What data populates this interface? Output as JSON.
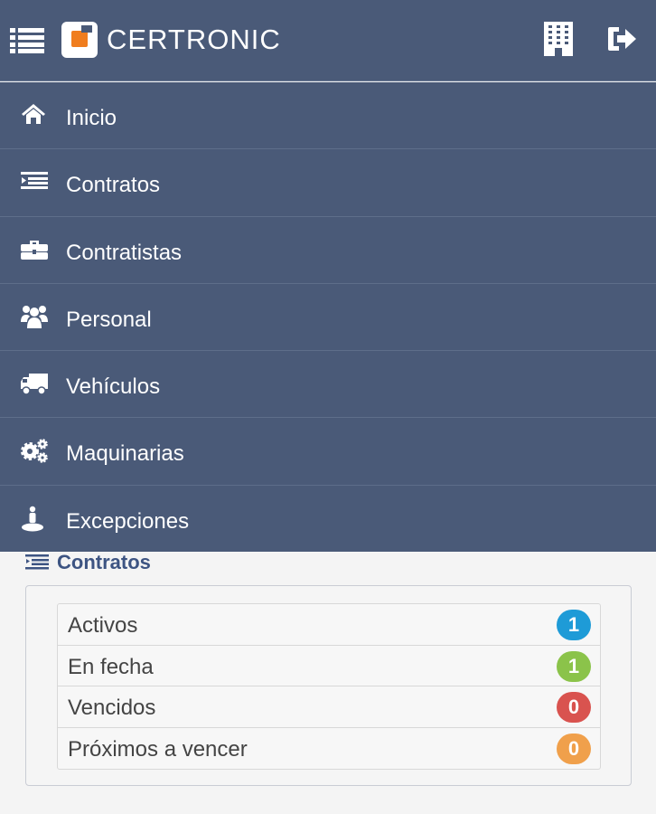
{
  "header": {
    "brand": "CERTRONIC",
    "icons": {
      "menu": "hamburger-icon",
      "building": "building-icon",
      "logout": "logout-icon"
    },
    "colors": {
      "bar": "#4a5a78",
      "logo_accent": "#f07d1e"
    }
  },
  "nav": {
    "items": [
      {
        "label": "Inicio",
        "icon": "home-icon"
      },
      {
        "label": "Contratos",
        "icon": "list-icon"
      },
      {
        "label": "Contratistas",
        "icon": "briefcase-icon"
      },
      {
        "label": "Personal",
        "icon": "users-icon"
      },
      {
        "label": "Vehículos",
        "icon": "truck-icon"
      },
      {
        "label": "Maquinarias",
        "icon": "gears-icon"
      },
      {
        "label": "Excepciones",
        "icon": "person-pin-icon"
      }
    ]
  },
  "contratos": {
    "title": "Contratos",
    "rows": [
      {
        "label": "Activos",
        "count": "1",
        "color": "#1e9bd7"
      },
      {
        "label": "En fecha",
        "count": "1",
        "color": "#8bc34a"
      },
      {
        "label": "Vencidos",
        "count": "0",
        "color": "#d9534f"
      },
      {
        "label": "Próximos a vencer",
        "count": "0",
        "color": "#f0a04b"
      }
    ]
  }
}
